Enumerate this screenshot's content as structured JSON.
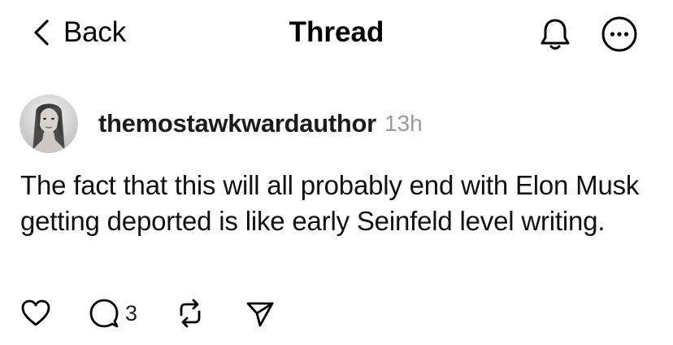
{
  "header": {
    "back_label": "Back",
    "title": "Thread",
    "icons": {
      "back": "chevron-left-icon",
      "notifications": "bell-icon",
      "more": "more-options-icon"
    }
  },
  "post": {
    "author": {
      "username": "themostawkwardauthor",
      "avatar": "avatar"
    },
    "timestamp": "13h",
    "text": "The fact that this will all probably end with Elon Musk getting deported is like early Seinfeld level writing.",
    "actions": {
      "like_icon": "heart-icon",
      "reply_icon": "comment-icon",
      "reply_count": "3",
      "repost_icon": "repost-icon",
      "share_icon": "send-icon"
    }
  },
  "colors": {
    "text": "#000000",
    "muted": "#9a9a9a",
    "background": "#ffffff"
  }
}
